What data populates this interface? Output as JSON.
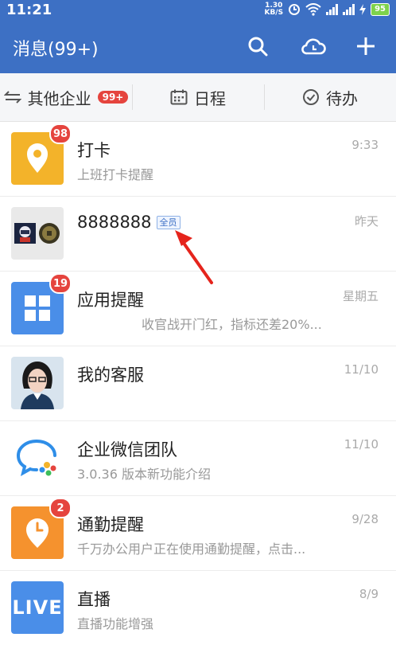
{
  "status_bar": {
    "time": "11:21",
    "speed_top": "1.30",
    "speed_bottom": "KB/S",
    "battery": "95"
  },
  "header": {
    "title": "消息(99+)",
    "icons": [
      "search-icon",
      "cloud-icon",
      "plus-icon"
    ]
  },
  "tabs": [
    {
      "label": "其他企业",
      "badge": "99+",
      "icon": "switch-icon"
    },
    {
      "label": "日程",
      "icon": "calendar-icon"
    },
    {
      "label": "待办",
      "icon": "check-circle-icon"
    }
  ],
  "messages": [
    {
      "name": "打卡",
      "subtitle": "上班打卡提醒",
      "time": "9:33",
      "badge": "98",
      "avatar_color": "#f3b32a",
      "icon": "location-pin-icon"
    },
    {
      "name": "8888888",
      "tag": "全员",
      "subtitle": "",
      "time": "昨天",
      "avatar_color": "#e9e9e9",
      "icon": "group-avatar-icon"
    },
    {
      "name": "应用提醒",
      "subtitle": "收官战开门红，指标还差20%...",
      "time": "星期五",
      "badge": "19",
      "avatar_color": "#4a8ee8",
      "icon": "grid-icon"
    },
    {
      "name": "我的客服",
      "subtitle": "",
      "time": "11/10",
      "avatar_color": "#d8e4ee",
      "icon": "support-person-icon"
    },
    {
      "name": "企业微信团队",
      "subtitle": "3.0.36 版本新功能介绍",
      "time": "11/10",
      "avatar_color": "#ffffff",
      "icon": "wecom-logo-icon"
    },
    {
      "name": "通勤提醒",
      "subtitle": "千万办公用户正在使用通勤提醒，点击...",
      "time": "9/28",
      "badge": "2",
      "avatar_color": "#f5922e",
      "icon": "clock-pin-icon"
    },
    {
      "name": "直播",
      "subtitle": "直播功能增强",
      "time": "8/9",
      "avatar_color": "#4a8ee8",
      "icon_text": "LIVE",
      "icon": "live-icon"
    }
  ]
}
